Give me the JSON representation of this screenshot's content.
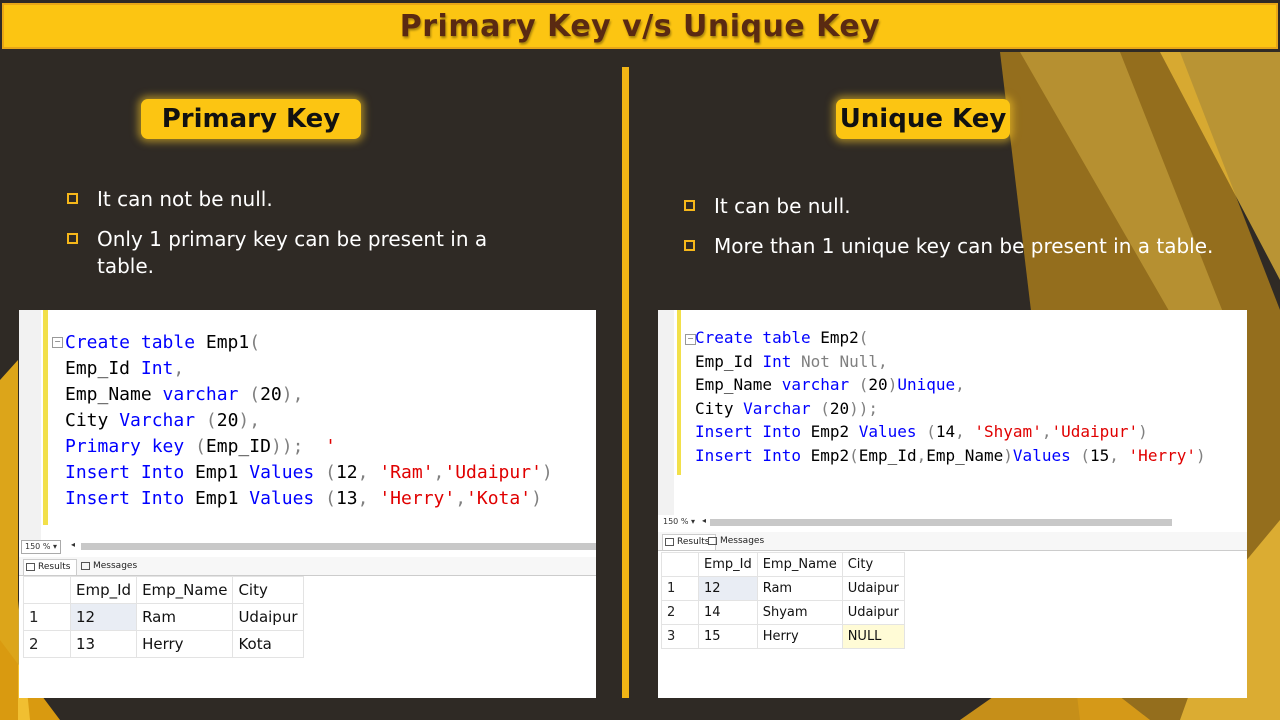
{
  "title": "Primary Key v/s Unique Key",
  "left": {
    "heading": "Primary Key",
    "bullets": [
      "It can not be null.",
      "Only 1 primary key can be present in a table."
    ],
    "zoom": "150 %",
    "tabs": [
      "Results",
      "Messages"
    ],
    "columns": [
      "Emp_Id",
      "Emp_Name",
      "City"
    ],
    "rows": [
      {
        "n": "1",
        "cells": [
          "12",
          "Ram",
          "Udaipur"
        ]
      },
      {
        "n": "2",
        "cells": [
          "13",
          "Herry",
          "Kota"
        ]
      }
    ]
  },
  "right": {
    "heading": "Unique Key",
    "bullets": [
      "It can be null.",
      "More than 1 unique key can be present in a table."
    ],
    "zoom": "150 %",
    "tabs": [
      "Results",
      "Messages"
    ],
    "columns": [
      "Emp_Id",
      "Emp_Name",
      "City"
    ],
    "rows": [
      {
        "n": "1",
        "cells": [
          "12",
          "Ram",
          "Udaipur"
        ]
      },
      {
        "n": "2",
        "cells": [
          "14",
          "Shyam",
          "Udaipur"
        ]
      },
      {
        "n": "3",
        "cells": [
          "15",
          "Herry",
          "NULL"
        ]
      }
    ]
  },
  "colors": {
    "accent": "#fcc512",
    "background": "#2f2a25",
    "title_text": "#5a2a12"
  }
}
